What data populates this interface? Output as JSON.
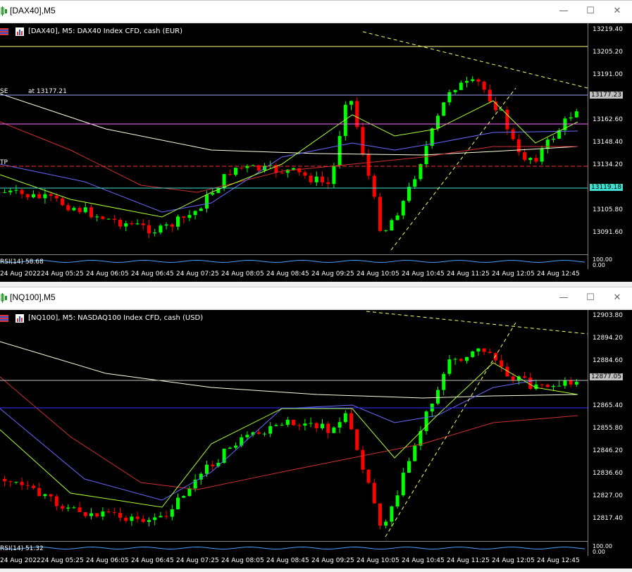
{
  "windows": [
    {
      "id": "dax",
      "title": "[DAX40],M5",
      "chart_header": "[DAX40], M5:  DAX40 Index CFD, cash (EUR)",
      "price_labels": [
        "13219.40",
        "13205.20",
        "13191.00",
        "13177.23",
        "13162.60",
        "13148.40",
        "13134.20",
        "13119.18",
        "13105.80",
        "13091.60"
      ],
      "current_price": "13177.23",
      "line_price": "13119.18",
      "se_label": "SE",
      "se_at": "at 13177.21",
      "tp_label": "TP",
      "rsi_label": "RSI(14) 58.68",
      "rsi_scale": [
        "100.00",
        "0.00"
      ],
      "time_labels": [
        "24 Aug 2022",
        "24 Aug 05:25",
        "24 Aug 06:05",
        "24 Aug 06:45",
        "24 Aug 07:25",
        "24 Aug 08:05",
        "24 Aug 08:45",
        "24 Aug 09:25",
        "24 Aug 10:05",
        "24 Aug 10:45",
        "24 Aug 11:25",
        "24 Aug 12:05",
        "24 Aug 12:45"
      ]
    },
    {
      "id": "nq",
      "title": "[NQ100],M5",
      "chart_header": "[NQ100], M5:  NASDAQ100 Index CFD, cash (USD)",
      "price_labels": [
        "12903.80",
        "12894.20",
        "12884.60",
        "12877.05",
        "12865.40",
        "12855.80",
        "12846.20",
        "12836.60",
        "12827.00",
        "12817.40"
      ],
      "current_price": "12877.05",
      "rsi_label": "RSI(14) 51.32",
      "rsi_scale": [
        "100.00",
        "0.00"
      ],
      "time_labels": [
        "24 Aug 2022",
        "24 Aug 05:25",
        "24 Aug 06:05",
        "24 Aug 06:45",
        "24 Aug 07:25",
        "24 Aug 08:05",
        "24 Aug 08:45",
        "24 Aug 09:25",
        "24 Aug 10:05",
        "24 Aug 10:45",
        "24 Aug 11:25",
        "24 Aug 12:05",
        "24 Aug 12:45"
      ]
    }
  ],
  "window_buttons": {
    "minimize": "—",
    "maximize": "☐",
    "close": "✕"
  },
  "colors": {
    "bull": "#00ff00",
    "bear": "#ff0000",
    "ma_fast": "#adff2f",
    "ma_mid": "#6a6aff",
    "ma_slow": "#d03030",
    "ma_long": "#ffffe0",
    "trend": "#ffff66",
    "grid_text": "#ffffff"
  }
}
